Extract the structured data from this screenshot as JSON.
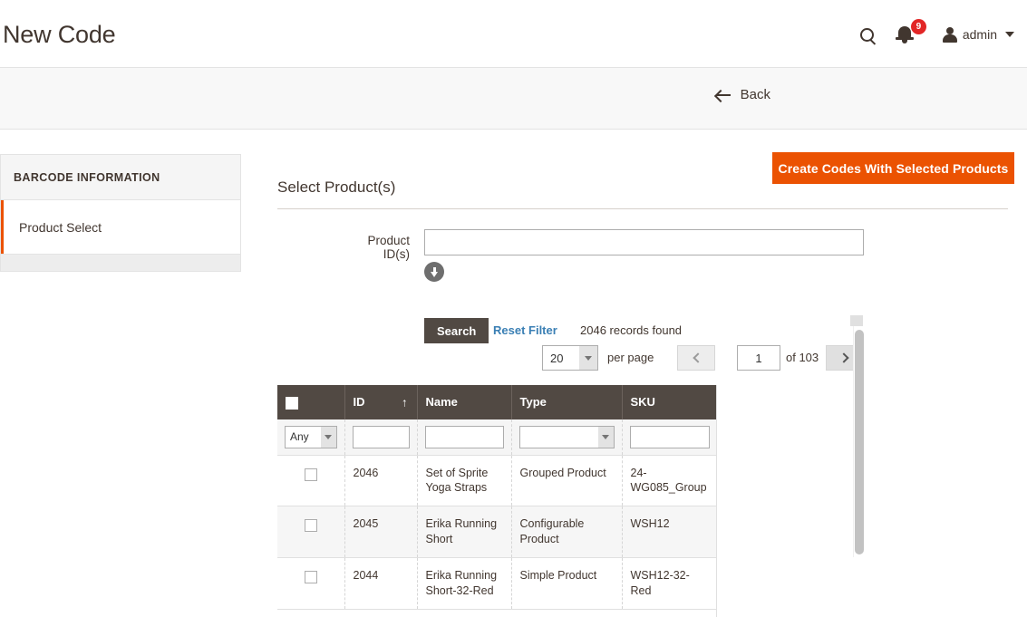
{
  "header": {
    "title": "New Code",
    "search_icon": "search-icon",
    "notifications_icon": "bell-icon",
    "notifications_count": "9",
    "user_icon": "user-icon",
    "user_name": "admin",
    "caret_icon": "chevron-down-icon"
  },
  "action_bar": {
    "back_icon": "arrow-left-icon",
    "back_label": "Back",
    "create_label": "Create Codes With Selected Products"
  },
  "sidebar": {
    "header": "BARCODE INFORMATION",
    "items": [
      {
        "label": "Product Select",
        "active": true
      }
    ]
  },
  "main": {
    "section_title": "Select Product(s)",
    "product_ids": {
      "label": "Product ID(s)",
      "value": "",
      "placeholder": "",
      "chooser_icon": "arrow-down-circle-icon"
    },
    "toolbar": {
      "search_label": "Search",
      "reset_label": "Reset Filter",
      "records_found": "2046 records found"
    },
    "pager": {
      "per_page_value": "20",
      "per_page_label": "per page",
      "prev_icon": "chevron-left-icon",
      "next_icon": "chevron-right-icon",
      "current_page": "1",
      "total_pages_label": "of 103"
    },
    "grid": {
      "columns": [
        {
          "key": "checkbox",
          "label": "",
          "icon": "checkbox-icon"
        },
        {
          "key": "id",
          "label": "ID",
          "sort": "asc",
          "sort_icon": "↑"
        },
        {
          "key": "name",
          "label": "Name"
        },
        {
          "key": "type",
          "label": "Type"
        },
        {
          "key": "sku",
          "label": "SKU"
        }
      ],
      "filters": {
        "checkbox": "Any",
        "id": "",
        "name": "",
        "type": "",
        "sku": ""
      },
      "rows": [
        {
          "checked": false,
          "id": "2046",
          "name": "Set of Sprite Yoga Straps",
          "type": "Grouped Product",
          "sku": "24-WG085_Group"
        },
        {
          "checked": false,
          "id": "2045",
          "name": "Erika Running Short",
          "type": "Configurable Product",
          "sku": "WSH12"
        },
        {
          "checked": false,
          "id": "2044",
          "name": "Erika Running Short-32-Red",
          "type": "Simple Product",
          "sku": "WSH12-32-Red"
        }
      ]
    }
  },
  "colors": {
    "accent_orange": "#eb5202",
    "dark_brown": "#514943",
    "link_blue": "#3a7fb4",
    "badge_red": "#e22626",
    "bar_bg": "#f8f8f8"
  }
}
